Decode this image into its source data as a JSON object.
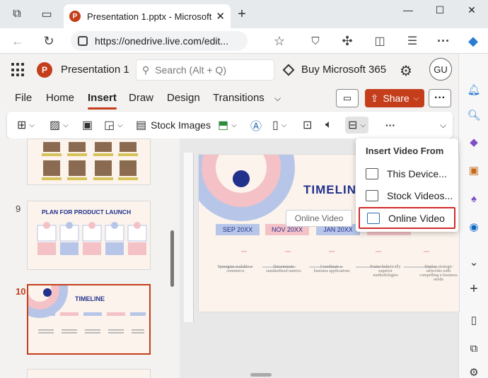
{
  "browser": {
    "tab_title": "Presentation 1.pptx - Microsoft P",
    "tab_close": "✕",
    "new_tab": "+",
    "url": "https://onedrive.live.com/edit...",
    "window": {
      "minimize": "—",
      "maximize": "☐",
      "close": "✕"
    }
  },
  "app": {
    "logo_letter": "P",
    "doc_name": "Presentation 1",
    "search_placeholder": "Search (Alt + Q)",
    "buy_label": "Buy Microsoft 365",
    "avatar_initials": "GU"
  },
  "ribbon": {
    "tabs": [
      "File",
      "Home",
      "Insert",
      "Draw",
      "Design",
      "Transitions"
    ],
    "active_tab": "Insert",
    "share_label": "Share",
    "more_label": "···",
    "stock_images_label": "Stock Images"
  },
  "slides": {
    "numbers": [
      "9",
      "10"
    ],
    "slide9_title": "PLAN FOR PRODUCT LAUNCH",
    "slide10_title": "TIMELINE"
  },
  "main_slide": {
    "title": "TIMELIN",
    "dates": [
      "SEP 20XX",
      "NOV 20XX",
      "JAN 20XX"
    ],
    "captions": [
      "Synergize scalable e-commerce",
      "Disseminate standardized metrics",
      "Coordinate e-business applications",
      "Foster holistically superior methodologies",
      "Deploy strategic networks with compelling e-business needs"
    ]
  },
  "tooltip": "Online Video",
  "dropdown": {
    "title": "Insert Video From",
    "items": [
      "This Device...",
      "Stock Videos...",
      "Online Video"
    ]
  },
  "colors": {
    "accent": "#c43e1c",
    "highlight": "#d12a2a",
    "navy": "#22318c",
    "pink": "#f4c1c7",
    "blue": "#b7c6e8"
  }
}
